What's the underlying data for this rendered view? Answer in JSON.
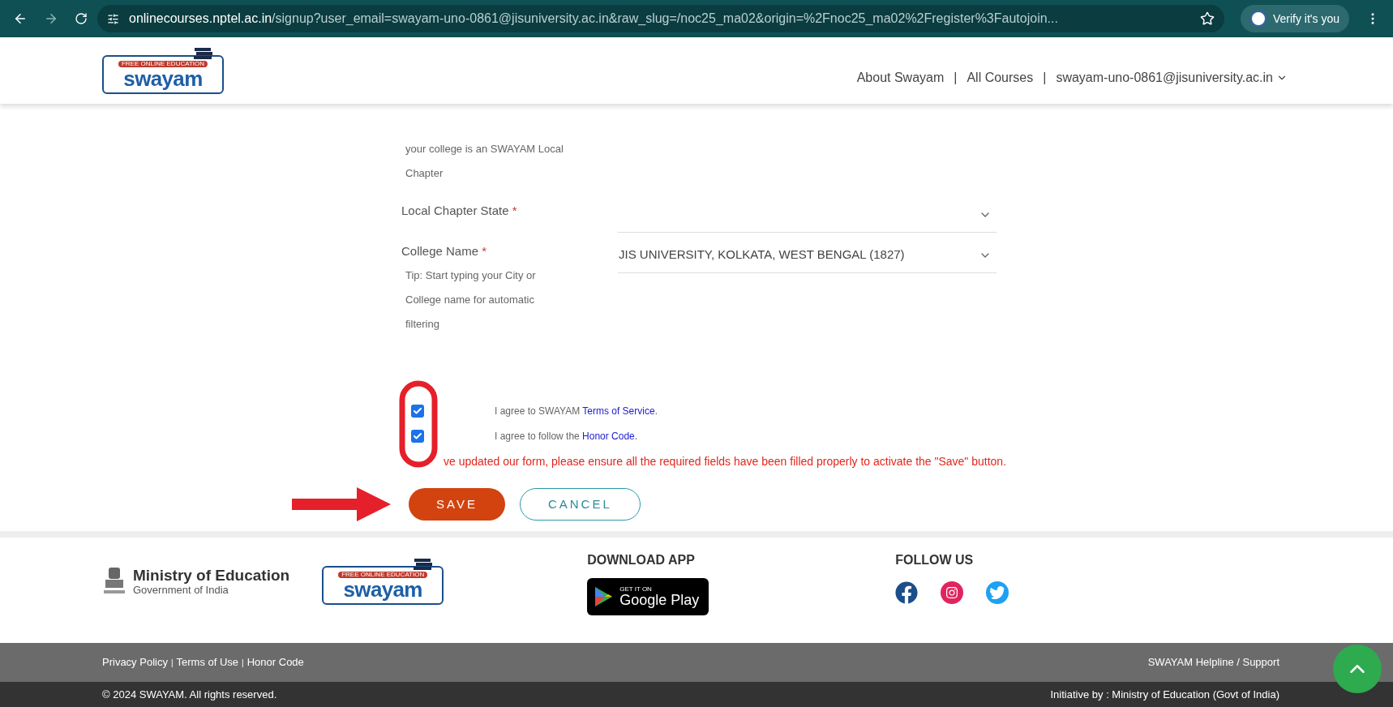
{
  "browser": {
    "url_host": "onlinecourses.nptel.ac.in",
    "url_path": "/signup?user_email=swayam-uno-0861@jisuniversity.ac.in&raw_slug=/noc25_ma02&origin=%2Fnoc25_ma02%2Fregister%3Fautojoin...",
    "profile_button": "Verify it's you"
  },
  "header": {
    "logo": {
      "tagline": "FREE ONLINE EDUCATION",
      "name": "swayam"
    },
    "nav": [
      {
        "label": "About Swayam",
        "dropdown": false
      },
      {
        "label": "All Courses",
        "dropdown": false
      },
      {
        "label": "swayam-uno-0861@jisuniversity.ac.in",
        "dropdown": true
      }
    ],
    "separators": [
      "|",
      "|"
    ]
  },
  "form": {
    "note": "your college is an SWAYAM Local Chapter",
    "fields": [
      {
        "label": "Local Chapter State",
        "required_mark": "*"
      },
      {
        "label": "College Name",
        "required_mark": "*",
        "value": "JIS UNIVERSITY, KOLKATA, WEST BENGAL (1827)",
        "tip": "Tip: Start typing your City or College name for automatic filtering"
      }
    ],
    "agreements": [
      {
        "prefix": "I agree to SWAYAM ",
        "link": "Terms of Service",
        "suffix": ".",
        "checked": true
      },
      {
        "prefix": "I agree to follow the ",
        "link": "Honor Code",
        "suffix": ".",
        "checked": true
      }
    ],
    "notice": "ve updated our form, please ensure all the required fields have been filled properly to activate the \"Save\" button.",
    "buttons": [
      {
        "label": "SAVE",
        "kind": "primary"
      },
      {
        "label": "CANCEL",
        "kind": "outline"
      }
    ]
  },
  "footer": {
    "ministry": {
      "title": "Ministry of Education",
      "subtitle": "Government of India"
    },
    "logo": {
      "tagline": "FREE ONLINE EDUCATION",
      "name": "swayam"
    },
    "download_app": {
      "heading": "DOWNLOAD APP",
      "badge_small": "GET IT ON",
      "badge": "Google Play"
    },
    "follow_us": {
      "heading": "FOLLOW US"
    },
    "links": [
      "Privacy Policy",
      "Terms of Use",
      "Honor Code"
    ],
    "link_separators": [
      "|",
      "|"
    ],
    "support": "SWAYAM Helpline / Support",
    "copyright": "© 2024 SWAYAM. All rights reserved.",
    "initiative": "Initiative by : Ministry of Education (Govt of India)"
  }
}
